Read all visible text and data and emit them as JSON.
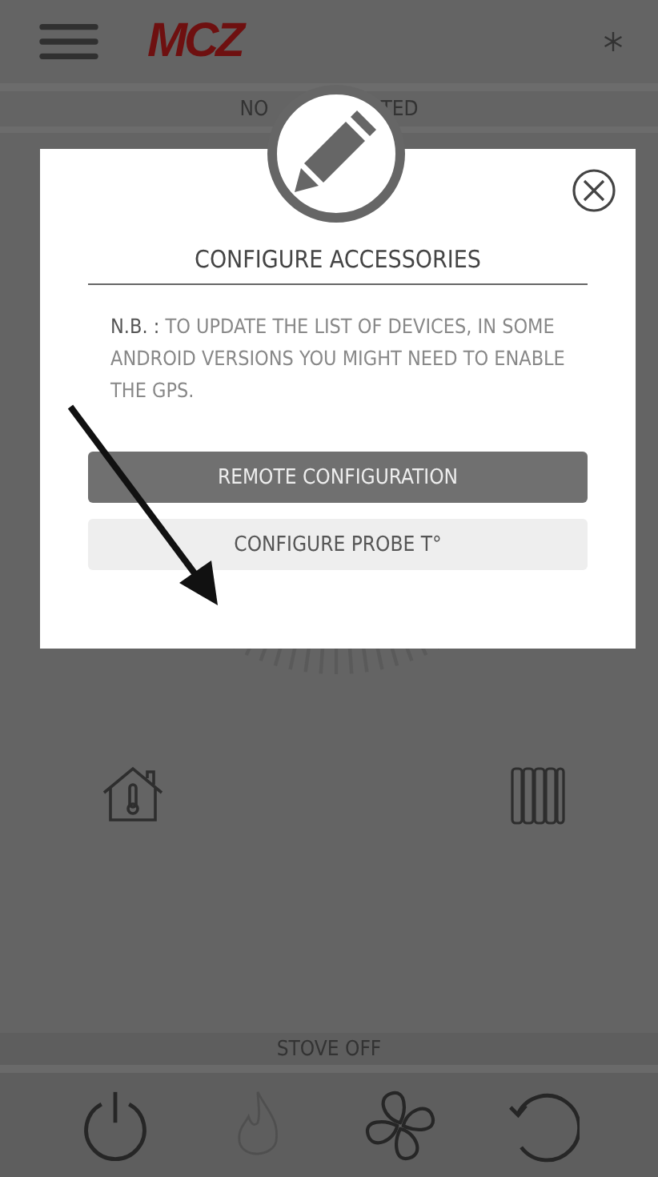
{
  "header": {
    "logo": "MCZ"
  },
  "status_fragments": [
    "NO",
    "TED"
  ],
  "dialog": {
    "title": "CONFIGURE ACCESSORIES",
    "note": "**N.B. :** TO UPDATE THE LIST OF DEVICES, IN SOME ANDROID VERSIONS YOU MIGHT NEED TO ENABLE THE GPS.",
    "buttons": [
      {
        "label": "REMOTE CONFIGURATION",
        "kind": "primary"
      },
      {
        "label": "CONFIGURE PROBE T°",
        "kind": "secondary"
      }
    ]
  },
  "stove_status": "STOVE OFF",
  "bottom_bar": [
    {
      "kind": "power",
      "disabled": false
    },
    {
      "kind": "flame",
      "disabled": true
    },
    {
      "kind": "fan",
      "disabled": false
    },
    {
      "kind": "reset",
      "disabled": false
    }
  ]
}
